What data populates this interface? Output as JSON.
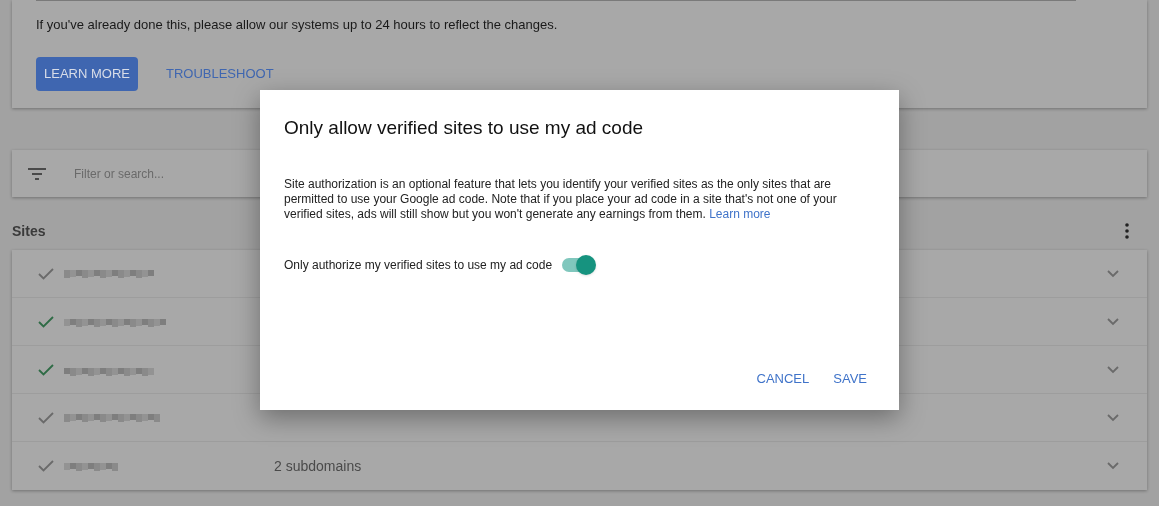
{
  "notice": {
    "text": "If you've already done this, please allow our systems up to 24 hours to reflect the changes.",
    "buttons": [
      {
        "label": "LEARN MORE",
        "kind": "filled"
      },
      {
        "label": "TROUBLESHOOT",
        "kind": "text"
      }
    ]
  },
  "search": {
    "placeholder": "Filter or search..."
  },
  "sites": {
    "heading": "Sites",
    "rows": [
      {
        "verified": false
      },
      {
        "verified": true
      },
      {
        "verified": true
      },
      {
        "verified": false
      },
      {
        "verified": false,
        "column_2": "2 subdomains"
      }
    ]
  },
  "dialog": {
    "title": "Only allow verified sites to use my ad code",
    "body": "Site authorization is an optional feature that lets you identify your verified sites as the only sites that are permitted to use your Google ad code. Note that if you place your ad code in a site that's not one of your verified sites, ads will still show but you won't generate any earnings from them.",
    "link": "Learn more",
    "toggle": {
      "label": "Only authorize my verified sites to use my ad code",
      "on": true
    },
    "buttons": [
      "CANCEL",
      "SAVE"
    ]
  }
}
